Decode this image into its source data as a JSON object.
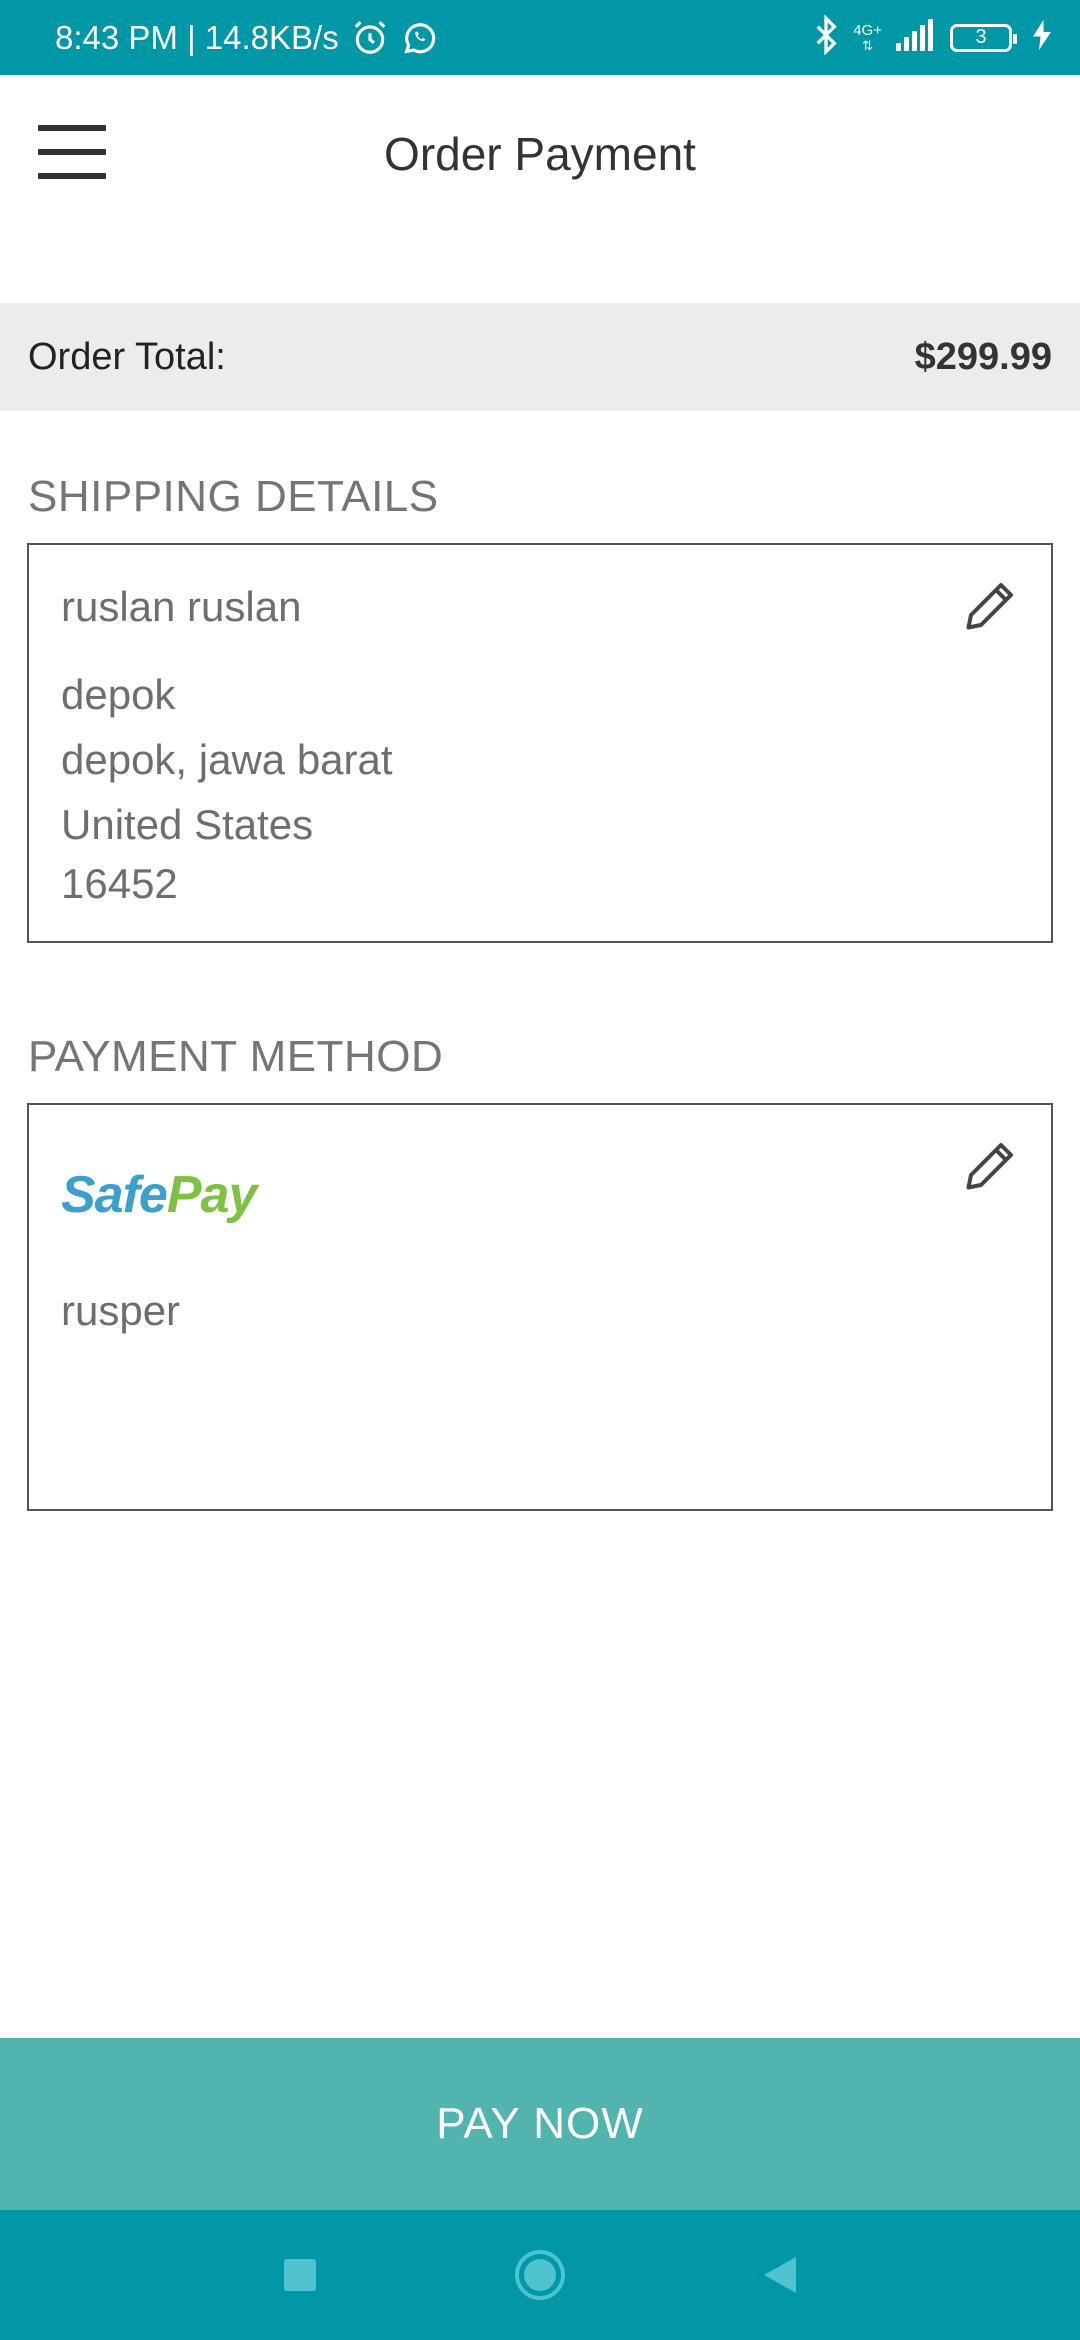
{
  "status_bar": {
    "time_and_speed": "8:43 PM | 14.8KB/s",
    "network_label": "4G+",
    "battery_level": "3",
    "icons": [
      "alarm-icon",
      "whatsapp-icon",
      "bluetooth-icon",
      "signal-icon",
      "battery-icon",
      "charging-icon"
    ]
  },
  "header": {
    "title": "Order Payment",
    "menu_icon": "hamburger-menu-icon"
  },
  "order_total": {
    "label": "Order Total:",
    "value": "$299.99"
  },
  "shipping": {
    "section_title": "SHIPPING DETAILS",
    "name": "ruslan ruslan",
    "address_line1": "depok",
    "address_line2": "depok, jawa barat",
    "country": "United States",
    "zip": "16452",
    "edit_icon": "pencil-icon"
  },
  "payment": {
    "section_title": "PAYMENT METHOD",
    "method_logo_part1": "Safe",
    "method_logo_part2": "Pay",
    "account": "rusper",
    "edit_icon": "pencil-icon"
  },
  "actions": {
    "pay_now_label": "PAY NOW"
  },
  "nav_bar": {
    "icons": [
      "recent-apps-icon",
      "home-icon",
      "back-icon"
    ]
  },
  "colors": {
    "status_bar": "#0097a7",
    "pay_button": "#52b4ae",
    "safepay_blue": "#3d9fcc",
    "safepay_green": "#7dc242"
  }
}
